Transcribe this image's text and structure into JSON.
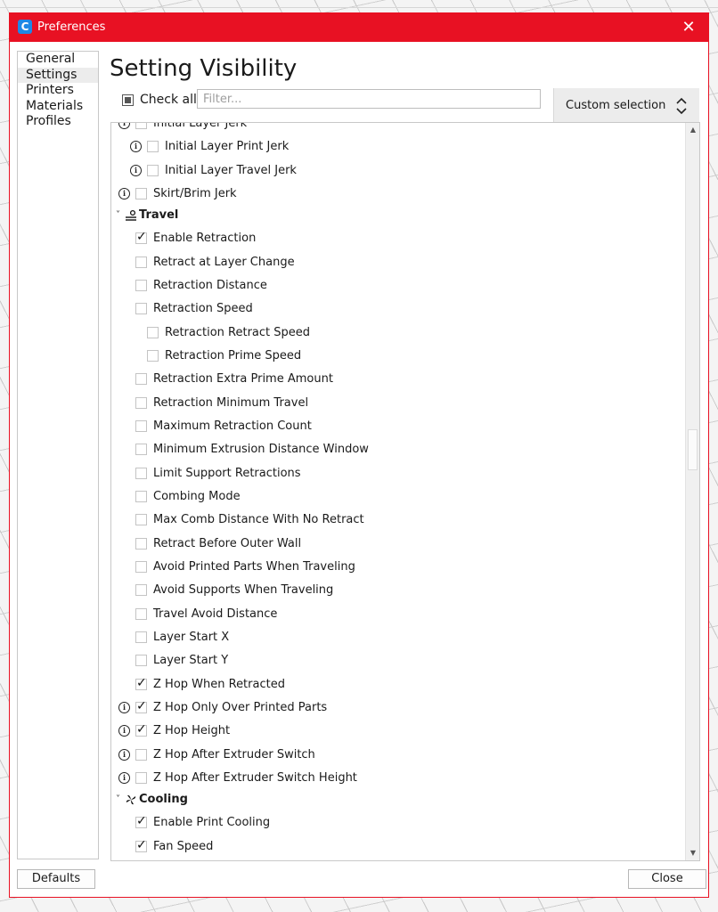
{
  "window": {
    "title": "Preferences",
    "icon_letter": "C",
    "close_glyph": "✕"
  },
  "sidebar": {
    "items": [
      {
        "label": "General"
      },
      {
        "label": "Settings"
      },
      {
        "label": "Printers"
      },
      {
        "label": "Materials"
      },
      {
        "label": "Profiles"
      }
    ],
    "active": "Settings"
  },
  "page": {
    "heading": "Setting Visibility",
    "check_all_label": "Check all",
    "filter_placeholder": "Filter...",
    "filter_value": "",
    "preset_selected": "Custom selection"
  },
  "settings": {
    "top_partial": {
      "label": "Initial Layer Jerk",
      "checked": false,
      "info": true
    },
    "jerk_rows": [
      {
        "label": "Initial Layer Print Jerk",
        "checked": false,
        "info": true,
        "indent": 1
      },
      {
        "label": "Initial Layer Travel Jerk",
        "checked": false,
        "info": true,
        "indent": 1
      },
      {
        "label": "Skirt/Brim Jerk",
        "checked": false,
        "info": true,
        "indent": 0
      }
    ],
    "travel": {
      "category": "Travel",
      "icon": "travel-icon",
      "rows": [
        {
          "label": "Enable Retraction",
          "checked": true,
          "info": false,
          "indent": 0
        },
        {
          "label": "Retract at Layer Change",
          "checked": false,
          "info": false,
          "indent": 0
        },
        {
          "label": "Retraction Distance",
          "checked": false,
          "info": false,
          "indent": 0
        },
        {
          "label": "Retraction Speed",
          "checked": false,
          "info": false,
          "indent": 0
        },
        {
          "label": "Retraction Retract Speed",
          "checked": false,
          "info": false,
          "indent": 1
        },
        {
          "label": "Retraction Prime Speed",
          "checked": false,
          "info": false,
          "indent": 1
        },
        {
          "label": "Retraction Extra Prime Amount",
          "checked": false,
          "info": false,
          "indent": 0
        },
        {
          "label": "Retraction Minimum Travel",
          "checked": false,
          "info": false,
          "indent": 0
        },
        {
          "label": "Maximum Retraction Count",
          "checked": false,
          "info": false,
          "indent": 0
        },
        {
          "label": "Minimum Extrusion Distance Window",
          "checked": false,
          "info": false,
          "indent": 0
        },
        {
          "label": "Limit Support Retractions",
          "checked": false,
          "info": false,
          "indent": 0
        },
        {
          "label": "Combing Mode",
          "checked": false,
          "info": false,
          "indent": 0
        },
        {
          "label": "Max Comb Distance With No Retract",
          "checked": false,
          "info": false,
          "indent": 0
        },
        {
          "label": "Retract Before Outer Wall",
          "checked": false,
          "info": false,
          "indent": 0
        },
        {
          "label": "Avoid Printed Parts When Traveling",
          "checked": false,
          "info": false,
          "indent": 0
        },
        {
          "label": "Avoid Supports When Traveling",
          "checked": false,
          "info": false,
          "indent": 0
        },
        {
          "label": "Travel Avoid Distance",
          "checked": false,
          "info": false,
          "indent": 0
        },
        {
          "label": "Layer Start X",
          "checked": false,
          "info": false,
          "indent": 0
        },
        {
          "label": "Layer Start Y",
          "checked": false,
          "info": false,
          "indent": 0
        },
        {
          "label": "Z Hop When Retracted",
          "checked": true,
          "info": false,
          "indent": 0
        },
        {
          "label": "Z Hop Only Over Printed Parts",
          "checked": true,
          "info": true,
          "indent": 0
        },
        {
          "label": "Z Hop Height",
          "checked": true,
          "info": true,
          "indent": 0
        },
        {
          "label": "Z Hop After Extruder Switch",
          "checked": false,
          "info": true,
          "indent": 0
        },
        {
          "label": "Z Hop After Extruder Switch Height",
          "checked": false,
          "info": true,
          "indent": 0
        }
      ]
    },
    "cooling": {
      "category": "Cooling",
      "icon": "fan-icon",
      "rows": [
        {
          "label": "Enable Print Cooling",
          "checked": true,
          "info": false,
          "indent": 0
        },
        {
          "label": "Fan Speed",
          "checked": true,
          "info": false,
          "indent": 0
        }
      ]
    }
  },
  "footer": {
    "defaults_label": "Defaults",
    "close_label": "Close"
  }
}
